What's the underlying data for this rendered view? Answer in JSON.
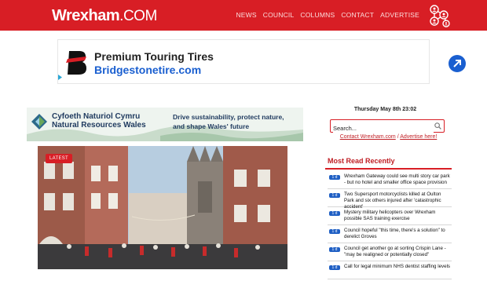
{
  "header": {
    "logo_main": "Wrexham",
    "logo_suffix": ".COM",
    "nav": [
      "NEWS",
      "COUNCIL",
      "COLUMNS",
      "CONTACT",
      "ADVERTISE"
    ],
    "network_icon": "people-network-icon",
    "brand_color": "#d81e25"
  },
  "ad_top": {
    "title": "Premium Touring Tires",
    "url": "Bridgestonetire.com",
    "brand_icon": "bridgestone-b-icon",
    "cta_icon": "arrow-right-circle-icon"
  },
  "ad_banner": {
    "org_line1": "Cyfoeth Naturiol Cymru",
    "org_line2": "Natural Resources Wales",
    "slogan": "Drive sustainability, protect nature, and shape Wales' future"
  },
  "feature": {
    "badge": "LATEST"
  },
  "sidebar": {
    "datetime": "Thursday May 8th 23:02",
    "search_placeholder": "Search...",
    "contact_link": "Contact Wrexham.com",
    "separator": " / ",
    "advertise_link": "Advertise here!",
    "most_read_title": "Most Read Recently",
    "most_read": [
      {
        "badge": "1 d",
        "text": "Wrexham Gateway could see multi story car park - but no hotel and smaller office space provision"
      },
      {
        "badge": "1 d",
        "text": "Two Supersport motorcyclists killed at Oulton Park and six others injured after 'catastrophic accident'"
      },
      {
        "badge": "1 d",
        "text": "Mystery military helicopters over Wrexham possible SAS training exercise"
      },
      {
        "badge": "1 d",
        "text": "Council hopeful \"this time, there's a solution\" to derelict Groves"
      },
      {
        "badge": "1 d",
        "text": "Council get another go at sorting Crispin Lane - \"may be realigned or potentially closed\""
      },
      {
        "badge": "1 d",
        "text": "Call for legal minimum NHS dentist staffing levels"
      }
    ]
  }
}
